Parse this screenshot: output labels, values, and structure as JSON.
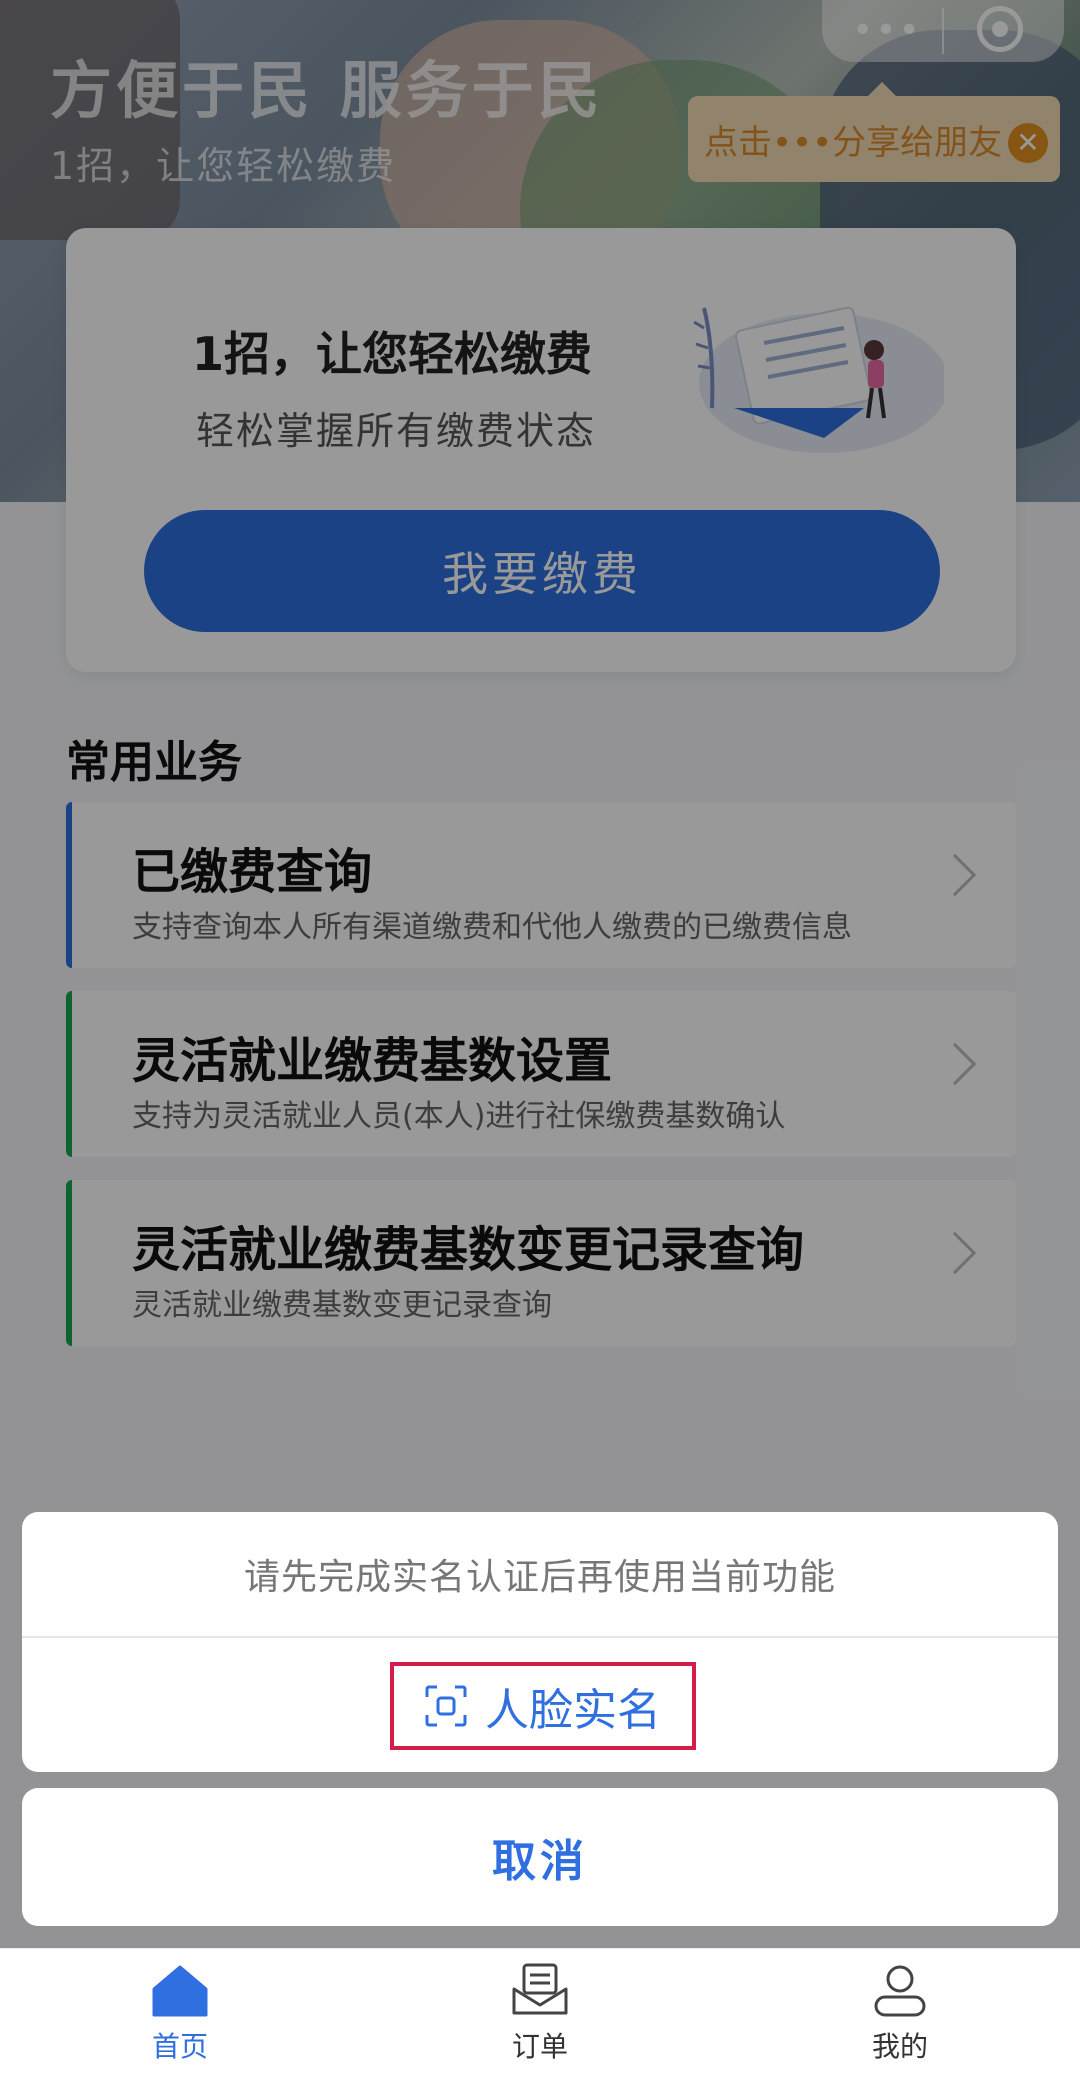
{
  "hero": {
    "title": "方便于民 服务于民",
    "subtitle": "1招，让您轻松缴费"
  },
  "capsule": {
    "more_icon": "more-dots-icon",
    "close_icon": "target-icon"
  },
  "share_tip": {
    "text": "点击•••分享给朋友",
    "close_glyph": "✕"
  },
  "pay_card": {
    "title": "1招，让您轻松缴费",
    "description": "轻松掌握所有缴费状态",
    "button_label": "我要缴费"
  },
  "section_title": "常用业务",
  "business": [
    {
      "title": "已缴费查询",
      "desc": "支持查询本人所有渠道缴费和代他人缴费的已缴费信息",
      "accent": "#2f6fe0"
    },
    {
      "title": "灵活就业缴费基数设置",
      "desc": "支持为灵活就业人员(本人)进行社保缴费基数确认",
      "accent": "#17a84c"
    },
    {
      "title": "灵活就业缴费基数变更记录查询",
      "desc": "灵活就业缴费基数变更记录查询",
      "accent": "#17a84c"
    }
  ],
  "action_sheet": {
    "message": "请先完成实名认证后再使用当前功能",
    "face_auth_label": "人脸实名",
    "cancel_label": "取消"
  },
  "tabbar": [
    {
      "label": "首页",
      "icon": "home-icon",
      "active": true
    },
    {
      "label": "订单",
      "icon": "order-icon",
      "active": false
    },
    {
      "label": "我的",
      "icon": "user-icon",
      "active": false
    }
  ],
  "colors": {
    "primary": "#2f6fe0",
    "highlight_border": "#d41e4a",
    "tip_bg": "#f3ddb4",
    "tip_text": "#d98d2e"
  }
}
